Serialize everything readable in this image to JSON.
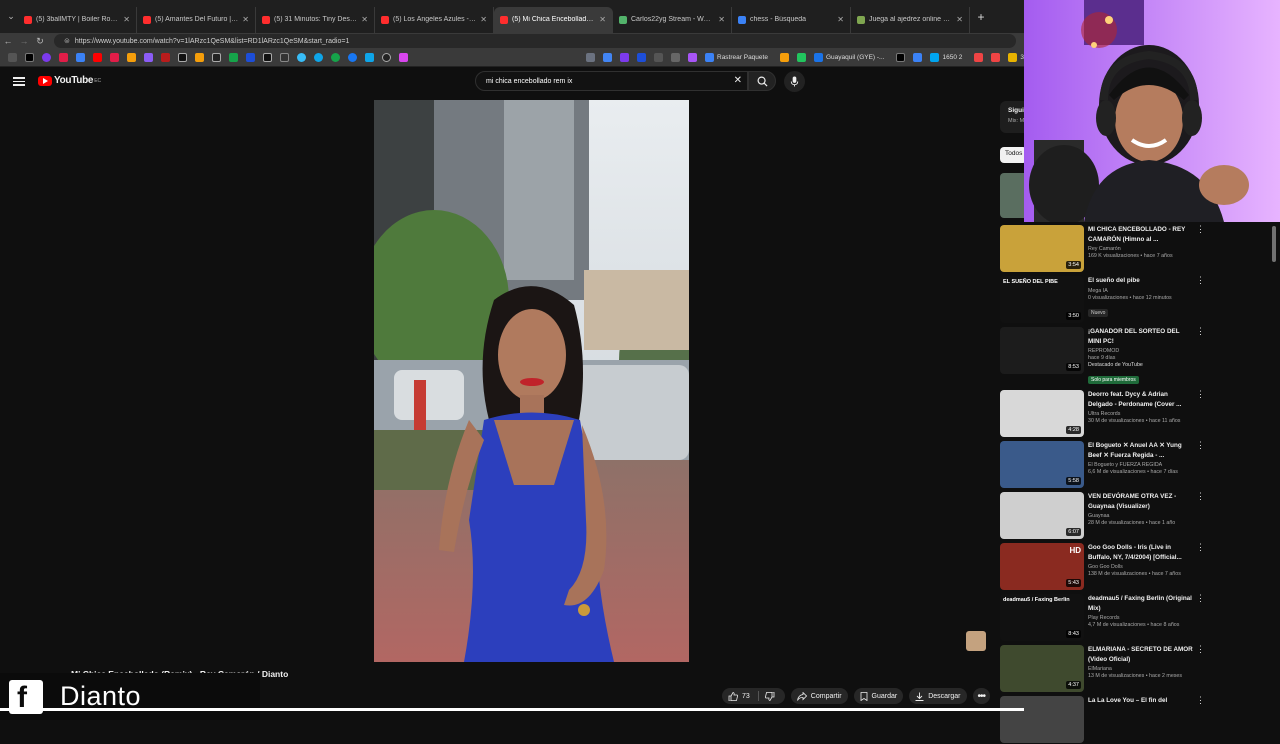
{
  "browser": {
    "tabs": [
      {
        "title": "(5) 3ballMTY | Boiler Room SYSTE",
        "color": "#ff2d2d"
      },
      {
        "title": "(5) Amantes Del Futuro | Boiler Ro",
        "color": "#ff2d2d"
      },
      {
        "title": "(5) 31 Minutos: Tiny Desk Concert",
        "color": "#ff2d2d"
      },
      {
        "title": "(5) Los Ángeles Azules - Nunc",
        "color": "#ff2d2d"
      },
      {
        "title": "(5) Mi Chica Encebollado (Remix)",
        "color": "#ff2d2d",
        "active": true
      },
      {
        "title": "Carlos22yg Stream - Watch Live c",
        "color": "#53b36b"
      },
      {
        "title": "chess - Búsqueda",
        "color": "#3b82f6"
      },
      {
        "title": "Juega al ajedrez online GRATIS - A",
        "color": "#7fa650"
      }
    ],
    "new_tab": "+",
    "url": "https://www.youtube.com/watch?v=1lARzc1QeSM&list=RD1lARzc1QeSM&start_radio=1",
    "bookmarks": [
      {
        "label": "Rastrear Paquete",
        "color": "#3b82f6"
      },
      {
        "label": "Guayaquil (GYE) -...",
        "color": "#1a73e8"
      },
      {
        "label": "1650 2",
        "color": "#00a4ef"
      },
      {
        "label": "3060",
        "color": "#e8b300"
      }
    ]
  },
  "youtube": {
    "logo_text": "YouTube",
    "country": "EC",
    "search_value": "mi chica encebollado rem ix",
    "video_title": "Mi Chica Encebollado (Remix) - Rey Camarón / Dianto",
    "actions": {
      "likes": "73",
      "share": "Compartir",
      "save": "Guardar",
      "download": "Descargar"
    },
    "sidebar": {
      "next_label": "Siguie",
      "next_sub": "Mix: M",
      "chip": "Todos",
      "items": [
        {
          "title": "MI CHICA ENCEBOLLADO - REY CAMARÓN (Himno al ...",
          "channel": "Rey Camarón",
          "meta": "169 K visualizaciones • hace 7 años",
          "duration": "3:54",
          "thumb": "#c9a23a"
        },
        {
          "title": "El sueño del pibe",
          "channel": "Mega IA",
          "meta": "0 visualizaciones • hace 12 minutos",
          "badge": "Nuevo",
          "duration": "3:50",
          "thumb": "#111111",
          "thumb_text": "EL SUEÑO DEL PIBE"
        },
        {
          "title": "¡GANADOR DEL SORTEO DEL MINI PC!",
          "channel": "REPROMOD",
          "meta": "hace 9 días",
          "extra": "Destacado de YouTube",
          "badge2": "Solo para miembros",
          "duration": "8:53",
          "thumb": "#1c1c1c"
        },
        {
          "title": "Deorro feat. Dycy & Adrian Delgado - Perdoname (Cover ...",
          "channel": "Ultra Records",
          "meta": "30 M de visualizaciones • hace 11 años",
          "duration": "4:28",
          "thumb": "#d8d8d8"
        },
        {
          "title": "El Bogueto ✕ Anuel AA ✕ Yung Beef ✕ Fuerza Regida - ...",
          "channel": "El Bogueto y FUERZA REGIDA",
          "meta": "6,6 M de visualizaciones • hace 7 días",
          "duration": "5:58",
          "thumb": "#3a5a8a"
        },
        {
          "title": "VEN DEVÓRAME OTRA VEZ - Guaynaa (Visualizer)",
          "channel": "Guaynaa",
          "meta": "28 M de visualizaciones • hace 1 año",
          "duration": "6:07",
          "thumb": "#cfcfcf"
        },
        {
          "title": "Goo Goo Dolls - Iris (Live in Buffalo, NY, 7/4/2004) [Official...",
          "channel": "Goo Goo Dolls",
          "meta": "138 M de visualizaciones • hace 7 años",
          "duration": "5:43",
          "thumb": "#8a2a20",
          "hd": "HD"
        },
        {
          "title": "deadmau5 / Faxing Berlin (Original Mix)",
          "channel": "Play Records",
          "meta": "4,7 M de visualizaciones • hace 8 años",
          "duration": "8:43",
          "thumb": "#111111",
          "thumb_text": "deadmau5 / Faxing Berlin"
        },
        {
          "title": "ELMARIANA - SECRETO DE AMOR (Video Oficial)",
          "channel": "ElMariana",
          "meta": "13 M de visualizaciones • hace 2 meses",
          "duration": "4:37",
          "thumb": "#3f4a2e"
        },
        {
          "title": "La La Love You – El fin del",
          "channel": "",
          "meta": "",
          "duration": "",
          "thumb": "#444444"
        }
      ]
    }
  },
  "overlay": {
    "fb_letter": "f",
    "streamer_name": "Dianto"
  }
}
